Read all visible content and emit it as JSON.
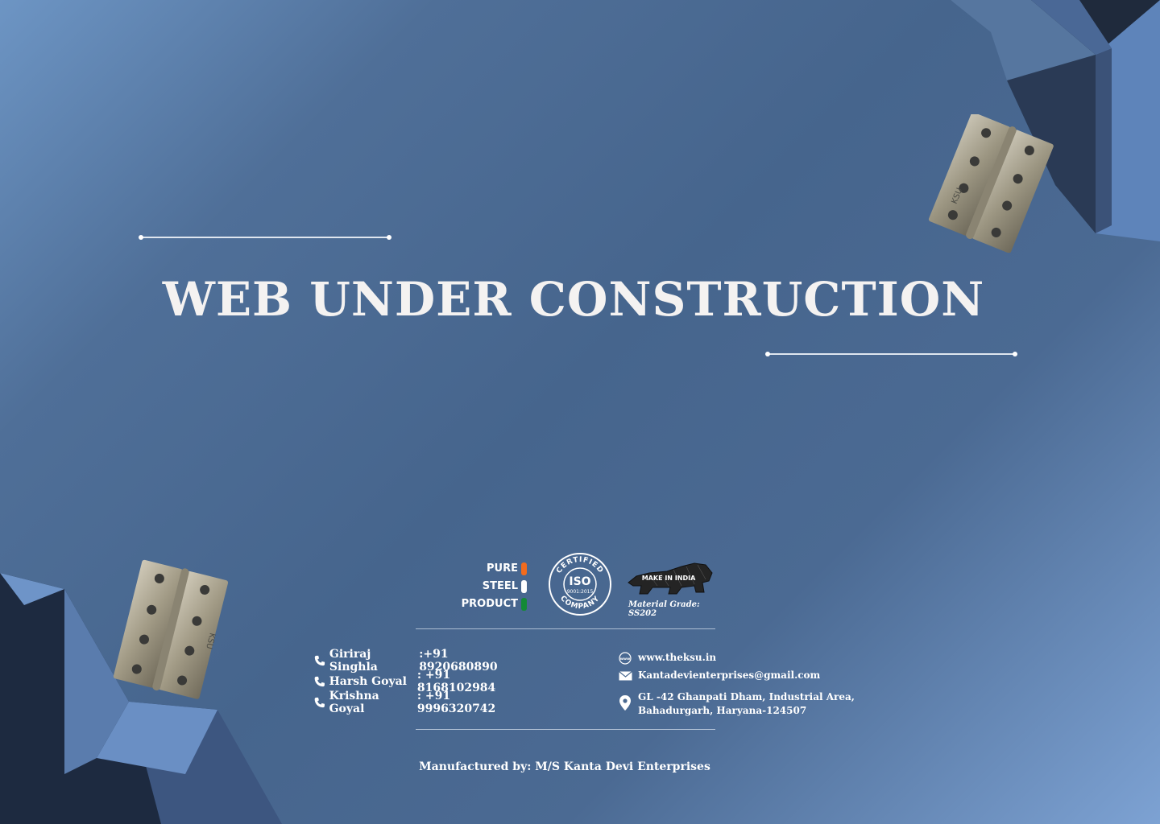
{
  "hero": {
    "title": "WEB UNDER CONSTRUCTION"
  },
  "badges": {
    "pure_steel": [
      "PURE",
      "STEEL",
      "PRODUCT"
    ],
    "iso": {
      "top": "CERTIFIED",
      "main": "ISO",
      "code": "9001:2015",
      "bottom": "COMPANY"
    },
    "make_in_india": "MAKE IN INDIA",
    "material_grade": "Material Grade: SS202"
  },
  "hinge_brand": "KSU",
  "contacts": [
    {
      "name": "Giriraj Singhla",
      "phone": ":+91 8920680890"
    },
    {
      "name": "Harsh Goyal",
      "phone": ": +91 8168102984"
    },
    {
      "name": "Krishna Goyal",
      "phone": ": +91 9996320742"
    }
  ],
  "info": {
    "website": "www.theksu.in",
    "email": "Kantadevienterprises@gmail.com",
    "address_line1": "GL -42 Ghanpati Dham, Industrial Area,",
    "address_line2": "Bahadurgarh, Haryana-124507"
  },
  "footer": {
    "credit": "Manufactured by: M/S Kanta Devi Enterprises"
  },
  "colors": {
    "saffron": "#f26b1d",
    "white": "#ffffff",
    "green": "#138a36",
    "background": "#4a6990"
  }
}
